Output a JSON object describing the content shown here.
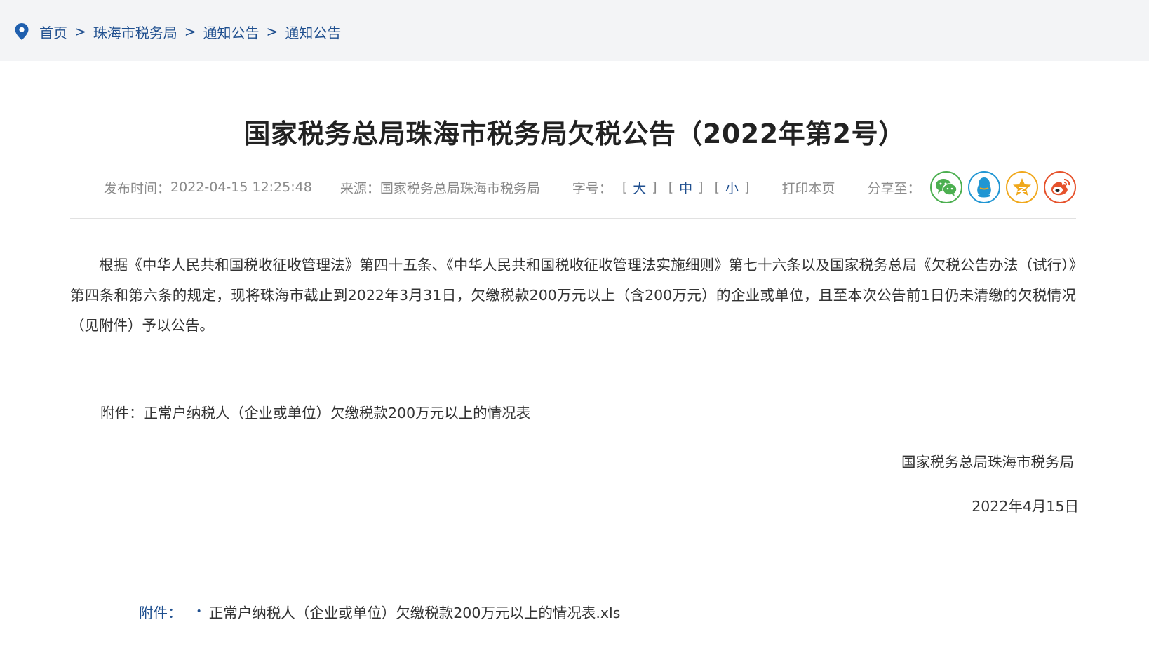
{
  "breadcrumb": {
    "items": [
      "首页",
      "珠海市税务局",
      "通知公告",
      "通知公告"
    ],
    "separator": ">"
  },
  "article": {
    "title": "国家税务总局珠海市税务局欠税公告（2022年第2号）",
    "meta": {
      "publish_label": "发布时间：",
      "publish_time": "2022-04-15 12:25:48",
      "source_label": "来源：",
      "source": "国家税务总局珠海市税务局",
      "font_size_label": "字号：",
      "font_large": "大",
      "font_medium": "中",
      "font_small": "小",
      "bracket_open": "[",
      "bracket_close": "]",
      "print_label": "打印本页",
      "share_label": "分享至："
    },
    "body": "根据《中华人民共和国税收征收管理法》第四十五条、《中华人民共和国税收征收管理法实施细则》第七十六条以及国家税务总局《欠税公告办法（试行）》第四条和第六条的规定，现将珠海市截止到2022年3月31日，欠缴税款200万元以上（含200万元）的企业或单位，且至本次公告前1日仍未清缴的欠税情况（见附件）予以公告。",
    "attachment_note": "附件：正常户纳税人（企业或单位）欠缴税款200万元以上的情况表",
    "signature": "国家税务总局珠海市税务局",
    "sign_date": "2022年4月15日"
  },
  "attachments": {
    "label": "附件：",
    "bullet": "•",
    "files": [
      "正常户纳税人（企业或单位）欠缴税款200万元以上的情况表.xls"
    ]
  },
  "share": {
    "icons": [
      "wechat-icon",
      "qq-icon",
      "qzone-icon",
      "weibo-icon"
    ]
  },
  "colors": {
    "link_blue": "#1f4f8f",
    "breadcrumb_bg": "#f3f4f6",
    "wechat": "#4caf50",
    "qq": "#2196d3",
    "qzone": "#f0a81c",
    "weibo": "#e6522c"
  }
}
